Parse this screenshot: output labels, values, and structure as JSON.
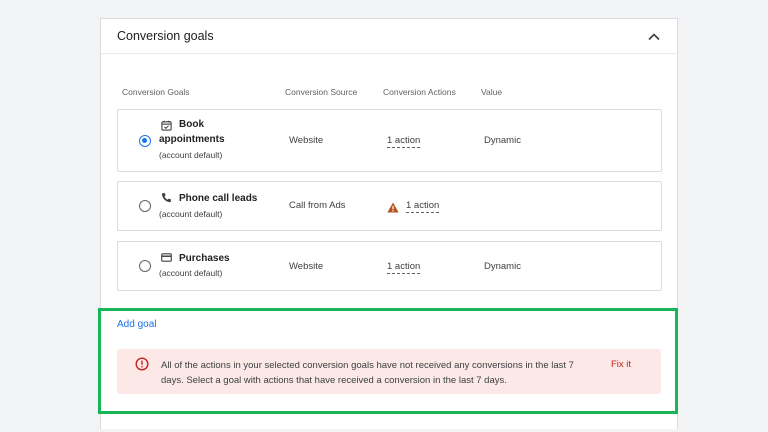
{
  "card": {
    "title": "Conversion goals"
  },
  "columns": [
    "Conversion Goals",
    "Conversion Source",
    "Conversion Actions",
    "Value"
  ],
  "goals": [
    {
      "name_line1": "Book",
      "name_line2": "appointments",
      "subtitle": "(account default)",
      "icon": "calendar-check-icon",
      "source": "Website",
      "actions": "1 action",
      "value": "Dynamic",
      "selected": true,
      "warning": false
    },
    {
      "name_line1": "Phone call leads",
      "subtitle": "(account default)",
      "icon": "phone-icon",
      "source": "Call from Ads",
      "actions": "1 action",
      "value": "",
      "selected": false,
      "warning": true
    },
    {
      "name_line1": "Purchases",
      "subtitle": "(account default)",
      "icon": "credit-card-icon",
      "source": "Website",
      "actions": "1 action",
      "value": "Dynamic",
      "selected": false,
      "warning": false
    }
  ],
  "add_goal_label": "Add goal",
  "alert": {
    "message": "All of the actions in your selected conversion goals have not received any conversions in the last 7 days. Select a goal with actions that have received a conversion in the last 7 days.",
    "action_label": "Fix it"
  },
  "colors": {
    "accent": "#1a73e8",
    "warning": "#c5221f",
    "alert_bg": "#fce8e6",
    "highlight": "#18b558",
    "warning_triangle": "#b3541e"
  }
}
